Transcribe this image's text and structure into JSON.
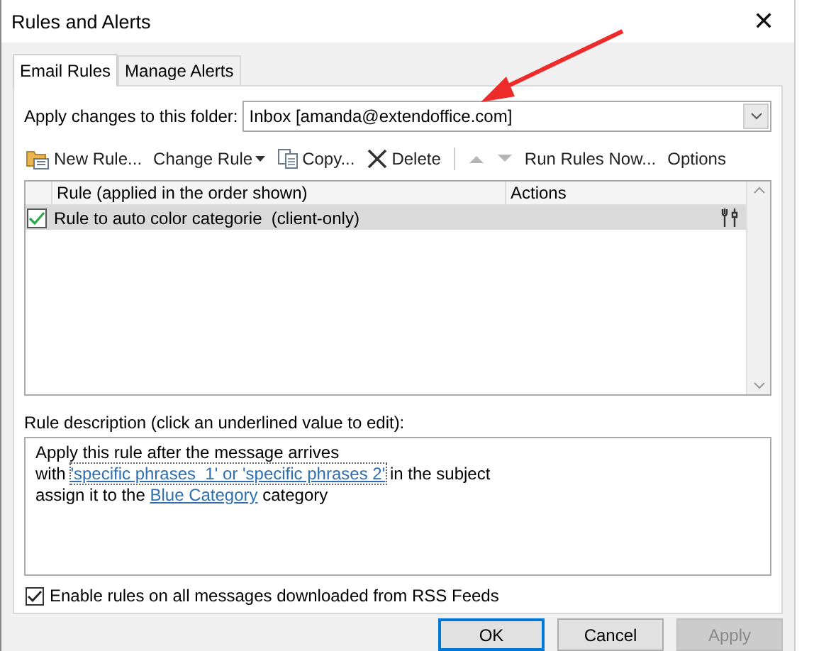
{
  "window": {
    "title": "Rules and Alerts",
    "close": "✕"
  },
  "tabs": [
    {
      "label": "Email Rules",
      "selected": true
    },
    {
      "label": "Manage Alerts",
      "selected": false
    }
  ],
  "folder": {
    "label": "Apply changes to this folder:",
    "value": "Inbox [amanda@extendoffice.com]"
  },
  "toolbar": [
    {
      "kind": "new",
      "label": "New Rule...",
      "disabled": false
    },
    {
      "kind": "change",
      "label": "Change Rule",
      "disabled": false
    },
    {
      "kind": "copy",
      "label": "Copy...",
      "disabled": false
    },
    {
      "kind": "delete",
      "label": "Delete",
      "disabled": false
    },
    {
      "kind": "up",
      "disabled": true
    },
    {
      "kind": "down",
      "disabled": true
    },
    {
      "kind": "text",
      "label": "Run Rules Now...",
      "disabled": false
    },
    {
      "kind": "text",
      "label": "Options",
      "disabled": false
    }
  ],
  "rules_table": {
    "columns": [
      "Rule (applied in the order shown)",
      "Actions"
    ],
    "rows": [
      {
        "name": "Rule to auto color categorie  (client-only)",
        "checked": true,
        "selected": true
      }
    ]
  },
  "description": {
    "label": "Rule description (click an underlined value to edit):",
    "lines": [
      [
        {
          "kind": "text",
          "text": "Apply this rule after the message arrives"
        }
      ],
      [
        {
          "kind": "text",
          "text": "with "
        },
        {
          "kind": "link",
          "text": "'specific phrases  1' or 'specific phrases 2'",
          "focused": true
        },
        {
          "kind": "text",
          "text": " in the subject"
        }
      ],
      [
        {
          "kind": "text",
          "text": "assign it to the "
        },
        {
          "kind": "link",
          "text": "Blue Category",
          "focused": false
        },
        {
          "kind": "text",
          "text": " category"
        }
      ]
    ]
  },
  "rss_option": {
    "label": "Enable rules on all messages downloaded from RSS Feeds",
    "checked": true
  },
  "buttons": [
    {
      "label": "OK",
      "default": true,
      "disabled": false
    },
    {
      "label": "Cancel",
      "default": false,
      "disabled": false
    },
    {
      "label": "Apply",
      "default": false,
      "disabled": true
    }
  ],
  "annotations": [
    {
      "kind": "arrow"
    }
  ]
}
